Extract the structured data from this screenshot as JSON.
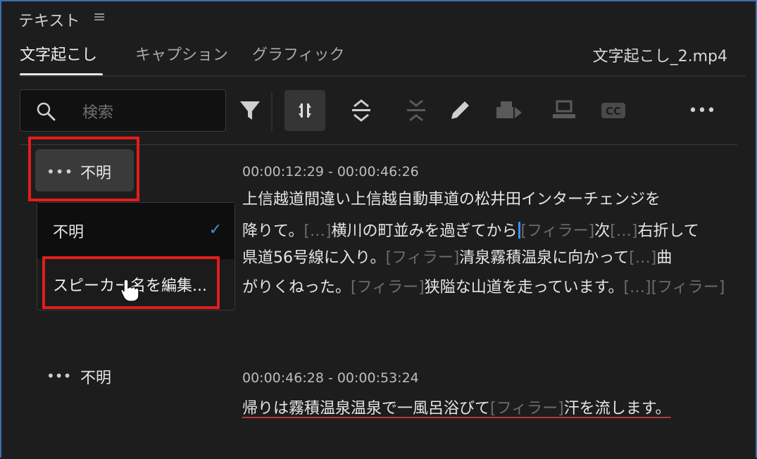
{
  "panel": {
    "title": "テキスト",
    "menu_glyph": "≡"
  },
  "tabs": [
    {
      "label": "文字起こし"
    },
    {
      "label": "キャプション"
    },
    {
      "label": "グラフィック"
    }
  ],
  "filename": "文字起こし_2.mp4",
  "search": {
    "placeholder": "検索"
  },
  "toolbar": {
    "icons": [
      "filter-icon",
      "split-icon",
      "expand-icon",
      "collapse-icon",
      "pencil-icon",
      "export-clip-icon",
      "screen-icon",
      "cc-icon",
      "more-icon"
    ],
    "cc_label": "CC",
    "more_label": "•••"
  },
  "segments": [
    {
      "speaker_dots": "•••",
      "speaker": "不明",
      "time": "00:00:12:29 - 00:00:46:26",
      "lines": [
        "上信越道間違い上信越自動車道の松井田インターチェンジを",
        "降りて。",
        "[…]",
        "横川の町並みを過ぎてから",
        "[フィラー]",
        "次",
        "[…]",
        "右折して",
        "県道56号線に入り。",
        "[フィラー]",
        "清泉霧積温泉に向かって",
        "[…]",
        "曲",
        "がりくねった。",
        "[フィラー]",
        "狭隘な山道を走っています。",
        "[…][フィラー]"
      ]
    },
    {
      "speaker_dots": "•••",
      "speaker": "不明",
      "time": "00:00:46:28 - 00:00:53:24",
      "line_a": "帰りは霧積温泉温泉で一風呂浴びて",
      "line_filler": "[フィラー]",
      "line_b": "汗を流します。"
    }
  ],
  "menu": {
    "item1": "不明",
    "check": "✓",
    "item2": "スピーカー名を編集..."
  },
  "colors": {
    "accent": "#3d8bff",
    "highlight": "#e21d1d"
  }
}
